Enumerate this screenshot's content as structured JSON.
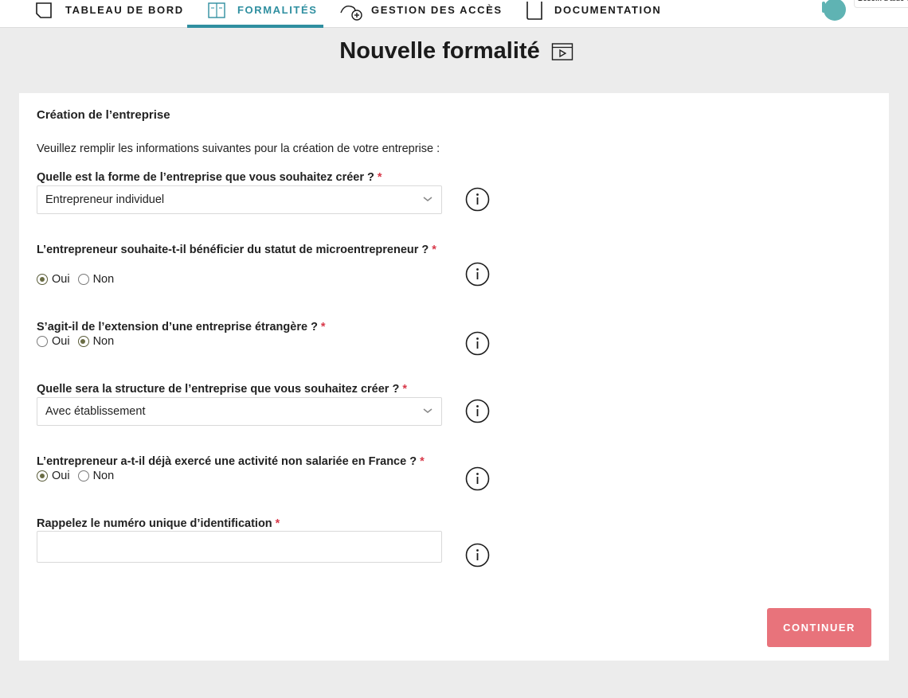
{
  "nav": {
    "items": [
      {
        "label": "TABLEAU DE BORD",
        "icon": "dashboard-icon"
      },
      {
        "label": "FORMALITÉS",
        "icon": "formalities-icon",
        "active": true
      },
      {
        "label": "GESTION DES ACCÈS",
        "icon": "access-management-icon"
      },
      {
        "label": "DOCUMENTATION",
        "icon": "documentation-icon"
      }
    ],
    "help_label": "Besoin d'aide ?",
    "accent_color": "#2f8fa0"
  },
  "page": {
    "title": "Nouvelle formalité",
    "title_icon": "video-tutorial-icon"
  },
  "form": {
    "section_title": "Création de l’entreprise",
    "intro": "Veuillez remplir les informations suivantes pour la création de votre entreprise :",
    "required_mark": "*",
    "q1": {
      "label": "Quelle est la forme de l’entreprise que vous souhaitez créer ?",
      "value": "Entrepreneur individuel"
    },
    "q2": {
      "label": "L’entrepreneur souhaite-t-il bénéficier du statut de microentrepreneur ?",
      "options": [
        "Oui",
        "Non"
      ],
      "selected": "Oui"
    },
    "q3": {
      "label": "S’agit-il de l’extension d’une entreprise étrangère ?",
      "options": [
        "Oui",
        "Non"
      ],
      "selected": "Non"
    },
    "q4": {
      "label": "Quelle sera la structure de l’entreprise que vous souhaitez créer ?",
      "value": "Avec établissement"
    },
    "q5": {
      "label": "L’entrepreneur a-t-il déjà exercé une activité non salariée en France ?",
      "options": [
        "Oui",
        "Non"
      ],
      "selected": "Oui"
    },
    "q6": {
      "label": "Rappelez le numéro unique d’identification",
      "value": ""
    },
    "continue_label": "CONTINUER",
    "button_color": "#e8737b",
    "required_color": "#d8394a"
  }
}
